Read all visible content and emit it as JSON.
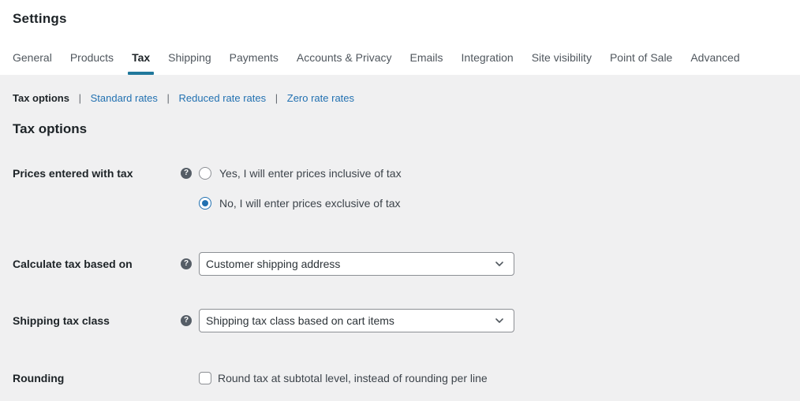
{
  "header": {
    "title": "Settings"
  },
  "tabs": [
    {
      "label": "General",
      "active": false
    },
    {
      "label": "Products",
      "active": false
    },
    {
      "label": "Tax",
      "active": true
    },
    {
      "label": "Shipping",
      "active": false
    },
    {
      "label": "Payments",
      "active": false
    },
    {
      "label": "Accounts & Privacy",
      "active": false
    },
    {
      "label": "Emails",
      "active": false
    },
    {
      "label": "Integration",
      "active": false
    },
    {
      "label": "Site visibility",
      "active": false
    },
    {
      "label": "Point of Sale",
      "active": false
    },
    {
      "label": "Advanced",
      "active": false
    }
  ],
  "subnav": {
    "separator": "|",
    "items": [
      {
        "label": "Tax options",
        "current": true
      },
      {
        "label": "Standard rates",
        "current": false
      },
      {
        "label": "Reduced rate rates",
        "current": false
      },
      {
        "label": "Zero rate rates",
        "current": false
      }
    ]
  },
  "section": {
    "heading": "Tax options"
  },
  "form": {
    "help_glyph": "?",
    "rows": [
      {
        "label": "Prices entered with tax",
        "type": "radio-group",
        "options": [
          {
            "label": "Yes, I will enter prices inclusive of tax",
            "selected": false
          },
          {
            "label": "No, I will enter prices exclusive of tax",
            "selected": true
          }
        ]
      },
      {
        "label": "Calculate tax based on",
        "type": "select",
        "value": "Customer shipping address"
      },
      {
        "label": "Shipping tax class",
        "type": "select",
        "value": "Shipping tax class based on cart items"
      },
      {
        "label": "Rounding",
        "type": "checkbox",
        "option_label": "Round tax at subtotal level, instead of rounding per line",
        "checked": false
      }
    ]
  },
  "colors": {
    "accent_link": "#2271b1",
    "active_tab_underline": "#20789c",
    "content_background": "#f0f0f1",
    "control_border": "#8c8f94",
    "text_primary": "#1d2327",
    "text_secondary": "#50575e"
  }
}
